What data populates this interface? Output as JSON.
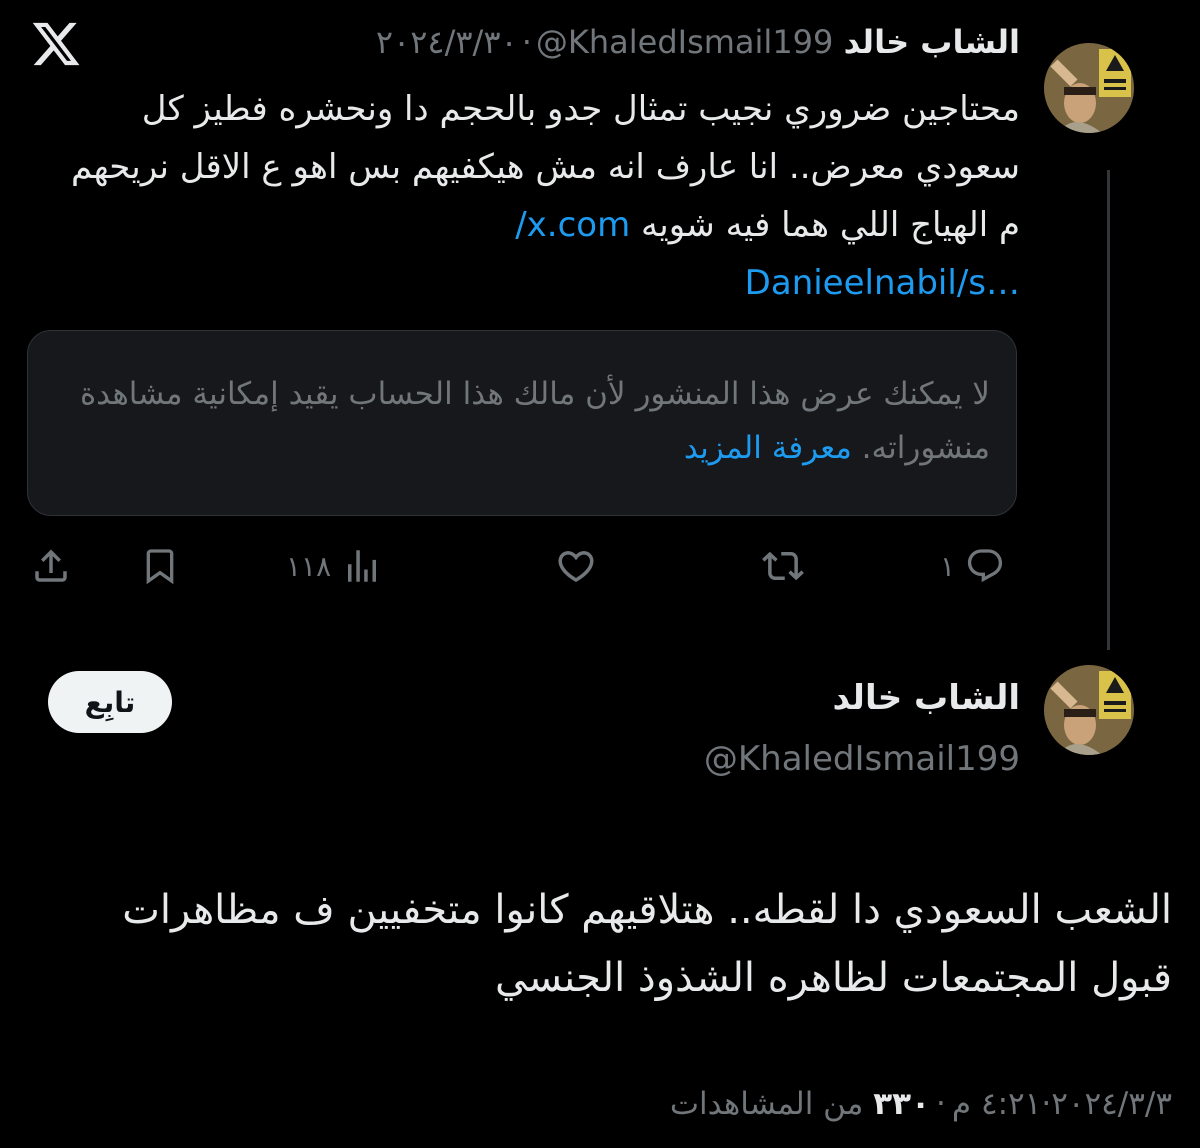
{
  "app": {
    "logo": "x-logo-icon"
  },
  "thread_tweet": {
    "display_name": "الشاب خالد",
    "handle": "@KhaledIsmail199",
    "separator": "·",
    "date": "٢٠٢٤/٣/٣٠",
    "text": "محتاجين ضروري نجيب تمثال جدو بالحجم دا ونحشره فطيز كل سعودي معرض.. انا عارف انه مش هيكفيهم بس اهو ع الاقل نريحهم م الهياج اللي هما فيه شويه",
    "link_line1": "/x.com",
    "link_line2": "Danieelnabil/s…",
    "unavailable_notice": {
      "text": "لا يمكنك عرض هذا المنشور لأن مالك هذا الحساب يقيد إمكانية مشاهدة منشوراته.",
      "learn_more": "معرفة المزيد"
    },
    "actions": {
      "reply_count": "١",
      "repost_count": "",
      "like_count": "",
      "views_count": "١١٨",
      "bookmark_count": "",
      "share_count": ""
    }
  },
  "main_tweet": {
    "display_name": "الشاب خالد",
    "handle": "@KhaledIsmail199",
    "follow_label": "تابِع",
    "text": "الشعب السعودي دا لقطه.. هتلاقيهم كانوا متخفيين ف مظاهرات قبول المجتمعات لظاهره الشذوذ الجنسي",
    "time": "٤:٢١ م",
    "date": "٢٠٢٤/٣/٣",
    "separator": "·",
    "views_count": "٣٣٠",
    "views_label": "من المشاهدات"
  },
  "colors": {
    "background": "#000000",
    "text_primary": "#e7e9ea",
    "text_secondary": "#71767b",
    "link": "#1d9bf0",
    "card_background": "#16181c",
    "border": "#2f3336"
  }
}
